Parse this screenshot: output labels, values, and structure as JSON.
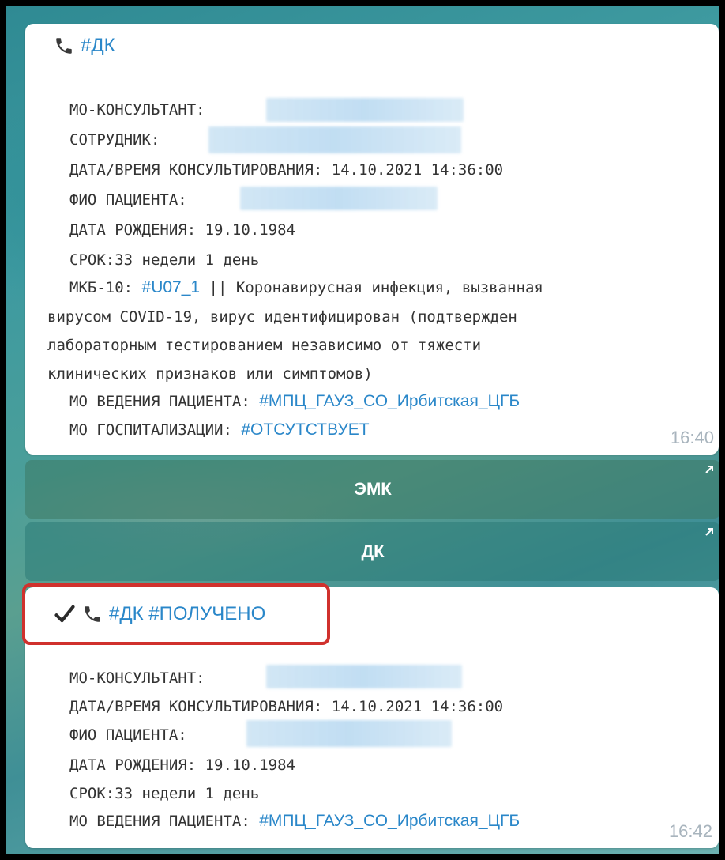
{
  "message1": {
    "header_tag": "#ДК",
    "lines": {
      "mo_consultant_label": "МО-КОНСУЛЬТАНТ:",
      "employee_label": "СОТРУДНИК:",
      "datetime_label": "ДАТА/ВРЕМЯ КОНСУЛЬТИРОВАНИЯ:",
      "datetime_value": "14.10.2021 14:36:00",
      "patient_label": "ФИО ПАЦИЕНТА:",
      "dob_label": "ДАТА РОЖДЕНИЯ:",
      "dob_value": "19.10.1984",
      "term_label": "СРОК:",
      "term_value": "33 недели 1 день",
      "icd_label": "МКБ-10:",
      "icd_tag": "#U07_1",
      "icd_sep": "||",
      "icd_text_1": "Коронавирусная инфекция, вызванная",
      "icd_text_2": "вирусом COVID-19, вирус идентифицирован (подтвержден",
      "icd_text_3": "лабораторным тестированием независимо от тяжести",
      "icd_text_4": "клинических признаков или симптомов)",
      "mo_lead_label": "МО ВЕДЕНИЯ ПАЦИЕНТА:",
      "mo_lead_tag": "#МПЦ_ГАУЗ_СО_Ирбитская_ЦГБ",
      "mo_hosp_label": "МО ГОСПИТАЛИЗАЦИИ:",
      "mo_hosp_tag": "#ОТСУТСТВУЕТ"
    },
    "time": "16:40"
  },
  "buttons": {
    "emk": "ЭМК",
    "dk": "ДК"
  },
  "message2": {
    "header_tag": "#ДК #ПОЛУЧЕНО",
    "lines": {
      "mo_consultant_label": "МО-КОНСУЛЬТАНТ:",
      "datetime_label": "ДАТА/ВРЕМЯ КОНСУЛЬТИРОВАНИЯ:",
      "datetime_value": "14.10.2021 14:36:00",
      "patient_label": "ФИО ПАЦИЕНТА:",
      "dob_label": "ДАТА РОЖДЕНИЯ:",
      "dob_value": "19.10.1984",
      "term_label": "СРОК:",
      "term_value": "33 недели 1 день",
      "mo_lead_label": "МО ВЕДЕНИЯ ПАЦИЕНТА:",
      "mo_lead_tag": "#МПЦ_ГАУЗ_СО_Ирбитская_ЦГБ"
    },
    "time": "16:42"
  },
  "colors": {
    "link": "#2a87c9",
    "highlight": "#d0312d"
  }
}
